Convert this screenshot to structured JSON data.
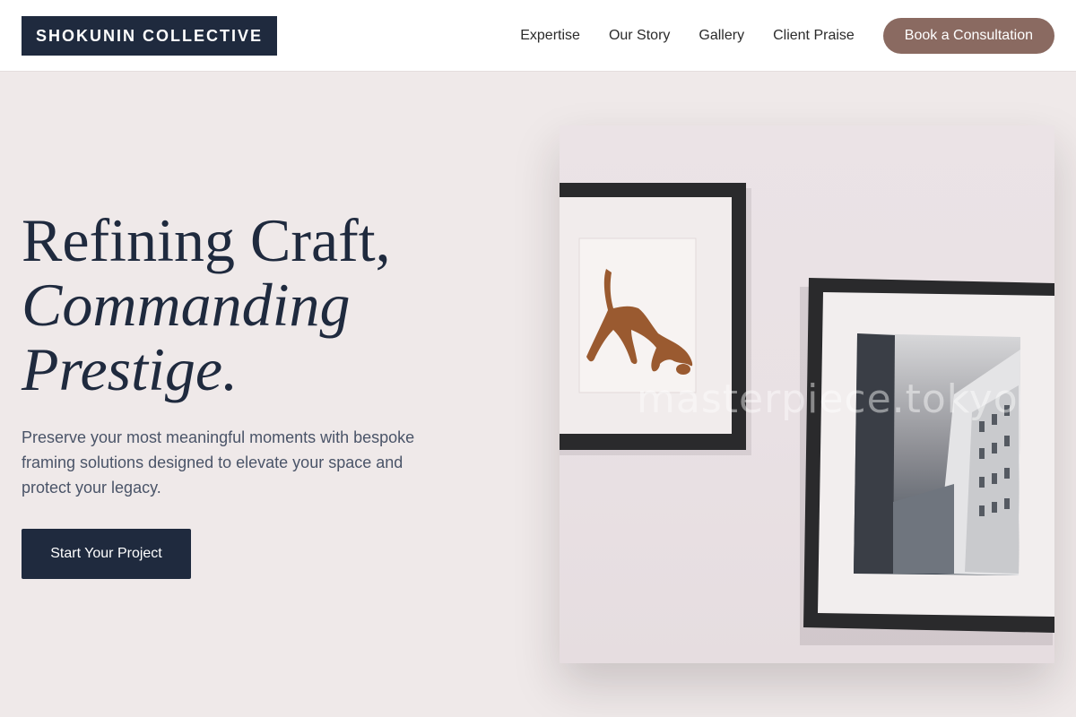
{
  "header": {
    "logo": "SHOKUNIN COLLECTIVE",
    "nav": [
      "Expertise",
      "Our Story",
      "Gallery",
      "Client Praise"
    ],
    "cta": "Book a Consultation"
  },
  "hero": {
    "title_line1": "Refining Craft,",
    "title_line2": "Commanding",
    "title_line3": "Prestige.",
    "description": "Preserve your most meaningful moments with bespoke framing solutions designed to elevate your space and protect your legacy.",
    "button": "Start Your Project"
  },
  "image": {
    "watermark": "masterpiece.tokyo",
    "subject": "framed artworks on a wall: sketch of a dog and a black-and-white city street photo"
  },
  "colors": {
    "navy": "#1f2a3e",
    "accent": "#8a6a61",
    "background": "#efe9e9",
    "body_text": "#4a5468"
  }
}
